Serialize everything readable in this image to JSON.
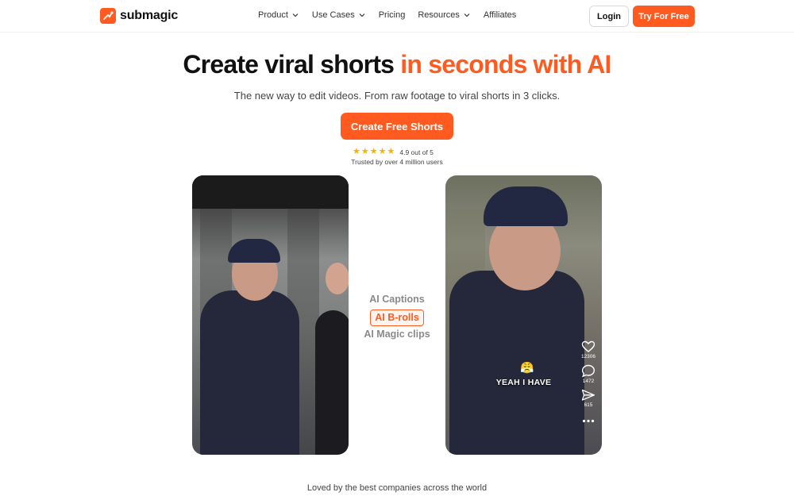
{
  "nav": {
    "logo_text": "submagic",
    "menu": [
      {
        "label": "Product",
        "has_dropdown": true
      },
      {
        "label": "Use Cases",
        "has_dropdown": true
      },
      {
        "label": "Pricing",
        "has_dropdown": false
      },
      {
        "label": "Resources",
        "has_dropdown": true
      },
      {
        "label": "Affiliates",
        "has_dropdown": false
      }
    ],
    "login_label": "Login",
    "try_label": "Try For Free"
  },
  "hero": {
    "title_main": "Create viral shorts",
    "title_accent": "in seconds with AI",
    "subtitle": "The new way to edit videos. From raw footage to viral shorts in 3 clicks.",
    "cta_label": "Create Free Shorts",
    "rating_text": "4.9 out of 5",
    "star_count": 5,
    "trusted_text": "Trusted by over 4 million users"
  },
  "features": [
    {
      "label": "AI Captions",
      "active": false
    },
    {
      "label": "AI B-rolls",
      "active": true
    },
    {
      "label": "AI Magic clips",
      "active": false
    }
  ],
  "video_right": {
    "caption_emoji": "😤",
    "caption_text": "YEAH I HAVE",
    "likes": "12306",
    "comments": "1472",
    "shares": "615"
  },
  "footer": {
    "loved_text": "Loved by the best companies across the world"
  },
  "colors": {
    "accent": "#ff5a1f",
    "star": "#f5b301"
  }
}
